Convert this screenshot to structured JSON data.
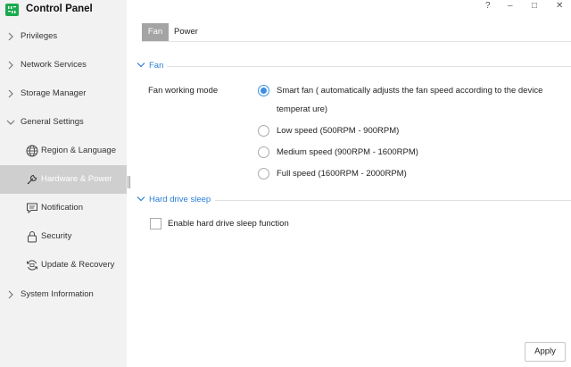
{
  "app": {
    "title": "Control Panel",
    "logo_icon": "nas-logo-icon",
    "brand_color": "#1aa94e"
  },
  "window_controls": {
    "help": "?",
    "minimize": "–",
    "maximize": "□",
    "close": "✕"
  },
  "sidebar": {
    "items": [
      {
        "label": "Privileges",
        "icon": "chevron-right-icon"
      },
      {
        "label": "Network Services",
        "icon": "chevron-right-icon"
      },
      {
        "label": "Storage Manager",
        "icon": "chevron-right-icon"
      },
      {
        "label": "General Settings",
        "icon": "chevron-down-icon",
        "expanded": true
      }
    ],
    "sub_items": [
      {
        "label": "Region & Language",
        "icon": "globe-icon"
      },
      {
        "label": "Hardware & Power",
        "icon": "wrench-icon",
        "active": true
      },
      {
        "label": "Notification",
        "icon": "message-icon"
      },
      {
        "label": "Security",
        "icon": "lock-icon"
      },
      {
        "label": "Update & Recovery",
        "icon": "refresh-icon"
      }
    ],
    "last_item": {
      "label": "System Information",
      "icon": "chevron-right-icon"
    }
  },
  "tabs": [
    {
      "label": "Fan",
      "active": true
    },
    {
      "label": "Power",
      "active": false
    }
  ],
  "fan_section": {
    "title": "Fan",
    "field_label": "Fan working mode",
    "options": [
      {
        "label": "Smart fan ( automatically adjusts the fan speed according to the device temperat ure)",
        "checked": true
      },
      {
        "label": "Low speed (500RPM - 900RPM)",
        "checked": false
      },
      {
        "label": "Medium speed (900RPM - 1600RPM)",
        "checked": false
      },
      {
        "label": "Full speed (1600RPM - 2000RPM)",
        "checked": false
      }
    ]
  },
  "hdd_section": {
    "title": "Hard drive sleep",
    "checkbox_label": "Enable hard drive sleep function",
    "checked": false
  },
  "footer": {
    "apply_label": "Apply"
  },
  "colors": {
    "accent": "#2a7ed6",
    "radio_checked": "#3b8ee0",
    "active_nav_bg": "#cfcfcf",
    "active_tab_bg": "#a4a4a4",
    "sidebar_bg": "#f2f2f2"
  }
}
